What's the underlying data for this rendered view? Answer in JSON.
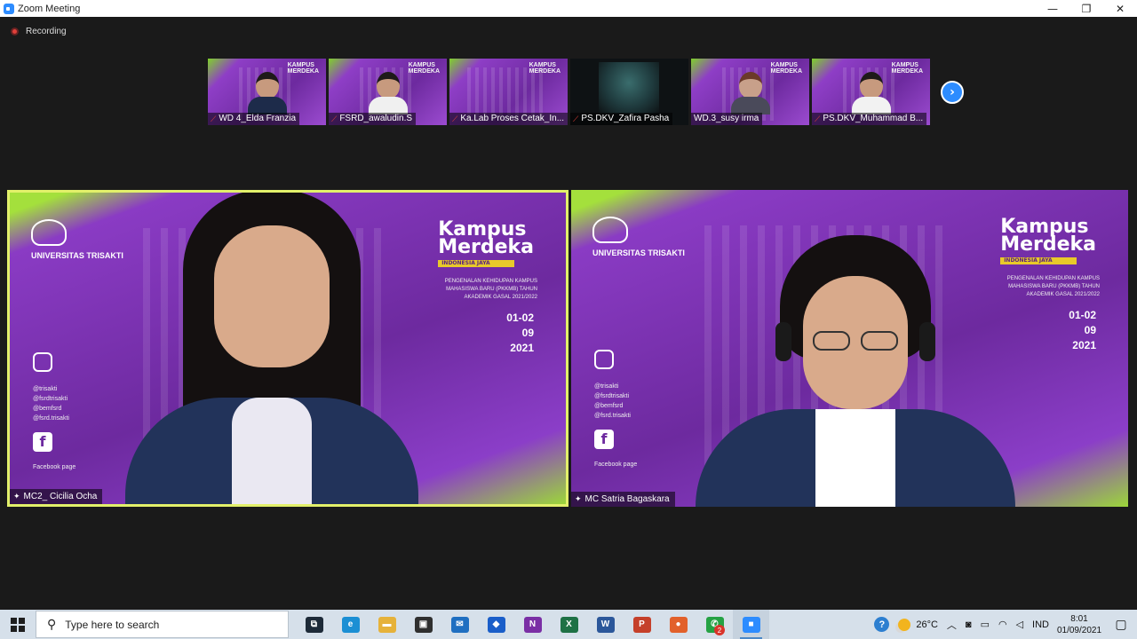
{
  "window": {
    "title": "Zoom Meeting",
    "minimize": "—",
    "maximize": "❐",
    "close": "✕"
  },
  "recording": {
    "label": "Recording"
  },
  "thumbnails": [
    {
      "name": "WD 4_Elda Franzia",
      "muted": true,
      "dark": false
    },
    {
      "name": "FSRD_awaludin.S",
      "muted": true,
      "dark": false
    },
    {
      "name": "Ka.Lab Proses Cetak_In...",
      "muted": true,
      "dark": false
    },
    {
      "name": "PS.DKV_Zafira Pasha",
      "muted": true,
      "dark": true
    },
    {
      "name": "WD.3_susy irma",
      "muted": false,
      "dark": false
    },
    {
      "name": "PS.DKV_Muhammad B...",
      "muted": true,
      "dark": false
    }
  ],
  "next_icon": "›",
  "main_tiles": [
    {
      "name": "MC2_ Cicilia Ocha",
      "active_speaker": true
    },
    {
      "name": "MC Satria Bagaskara",
      "active_speaker": false
    }
  ],
  "taskbar": {
    "search_placeholder": "Type here to search",
    "apps": [
      {
        "icon": "task-view-icon",
        "glyph": "⧉",
        "color": "#1d2a38"
      },
      {
        "icon": "edge-icon",
        "glyph": "e",
        "color": "#1b8fd4"
      },
      {
        "icon": "file-explorer-icon",
        "glyph": "▬",
        "color": "#e6b23a"
      },
      {
        "icon": "store-icon",
        "glyph": "▣",
        "color": "#2f2f2f"
      },
      {
        "icon": "mail-icon",
        "glyph": "✉",
        "color": "#1f6fc1"
      },
      {
        "icon": "dropbox-icon",
        "glyph": "◆",
        "color": "#1a5ec9"
      },
      {
        "icon": "onenote-icon",
        "glyph": "N",
        "color": "#7a2fa5"
      },
      {
        "icon": "excel-icon",
        "glyph": "X",
        "color": "#1e7145"
      },
      {
        "icon": "word-icon",
        "glyph": "W",
        "color": "#2b579a"
      },
      {
        "icon": "powerpoint-icon",
        "glyph": "P",
        "color": "#c5402a"
      },
      {
        "icon": "firefox-icon",
        "glyph": "●",
        "color": "#e2612b"
      },
      {
        "icon": "whatsapp-icon",
        "glyph": "✆",
        "color": "#25a244",
        "badge": "2"
      },
      {
        "icon": "zoom-icon",
        "glyph": "■",
        "color": "#2d8cff"
      }
    ],
    "weather": "26°C",
    "language": "IND",
    "time": "8:01",
    "date": "01/09/2021"
  }
}
